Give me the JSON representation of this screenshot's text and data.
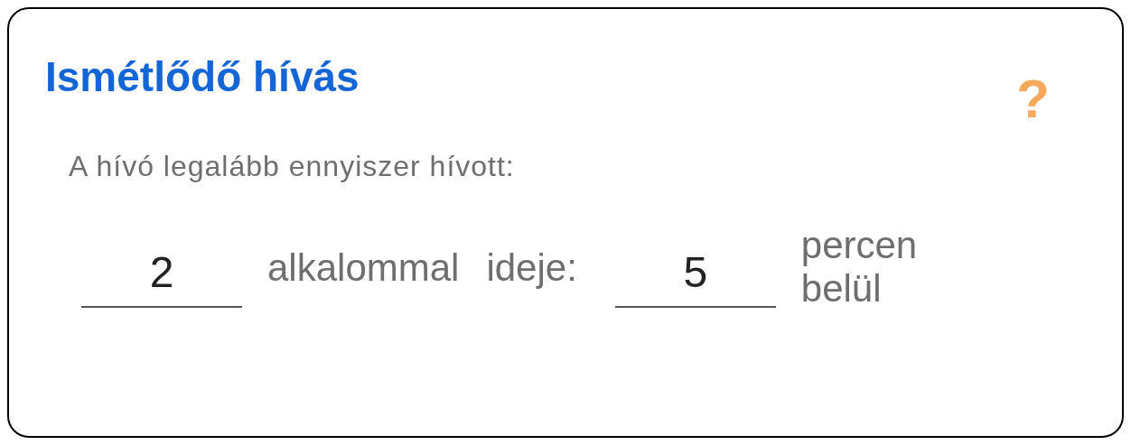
{
  "title": "Ismétlődő hívás",
  "help_icon": "?",
  "prompt": "A hívó legalább ennyiszer hívott:",
  "count_field": {
    "value": "2"
  },
  "count_unit": "alkalommal",
  "time_label": "ideje:",
  "time_field": {
    "value": "5"
  },
  "time_unit": "percen belül"
}
